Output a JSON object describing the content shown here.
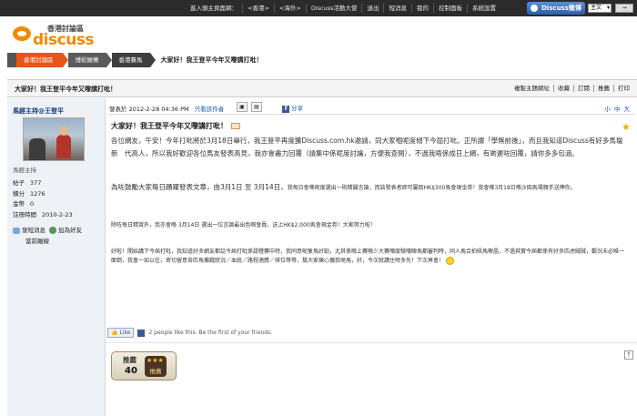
{
  "topnav": {
    "links": [
      "進入頭主頁面網：",
      "<香港>",
      "<海外>",
      "Discuss活動大使",
      "退出",
      "短消息",
      "我的",
      "控制面板",
      "系統設置"
    ],
    "brand": "Discuss微博",
    "language": "主文",
    "collapse_label": "→"
  },
  "logo": {
    "cn": "香港討論區",
    "en": "discuss"
  },
  "breadcrumb": {
    "items": [
      "香港討論區",
      "博彩娛樂",
      "香港賽馬"
    ],
    "current": "大家好！我王登平今年又嚟講打吡！"
  },
  "thread": {
    "title": "大家好！我王登平今年又嚟講打吡！",
    "actions": [
      "複製主題網址",
      "收藏",
      "訂閱",
      "推薦",
      "打印"
    ]
  },
  "user": {
    "name": "馬經主持@王登平",
    "rank": "馬經主持",
    "stats": [
      {
        "label": "帖子",
        "value": "377"
      },
      {
        "label": "積分",
        "value": "1276"
      },
      {
        "label": "金幣",
        "value": "0"
      },
      {
        "label": "註冊時間",
        "value": "2010-2-23"
      }
    ],
    "send_pm": "發短消息",
    "add_friend": "加為好友",
    "status": "當前離線"
  },
  "post": {
    "posted": "發表於 2012-2-28 04:36 PM",
    "only_author": "只看該作者",
    "share": "分享",
    "font_sizes": "小 中 大",
    "post_number": "1#",
    "title": "大家好！我王登平今年又嚟講打吡！",
    "p1": "各位網友，午安！今年打吡將於3月18日舉行，我王登平再度獲Discuss.com.hk邀請，同大家嗰呢度傾下今屆打吡。正所謂「學無前後」，而且我知道Discuss有好多馬壇新　代高人，所以我好歡迎各位馬友發表高見，我亦會盡力回覆（請集中係呢度討論，方便我查閱），不過我唔係成日上網，有啲遲咗回覆，請你多多包涵。",
    "p2a": "為咗鼓勵大家每日踴躍發表文章，由3月1日 至 3月14日，",
    "p2b": "我每日會喺呢度選出一則精闢言論，而該發表者即可贏取HK$300馬會現金券！我會喺3月18日喺沙田馬場親手送俾你。",
    "p3a": "除咗每日精賞外，我亦會喺 3月14日 選出一位言論最出色嘅會員，送上HK$2,000馬會現金券！大家努力啦！",
    "p4": "好啦！開始講下今屆打吡，我知道好多網友都話今屆打吡係甜橙賽中特，我同意呢隻馬好勁，尤其係喺上賽喺少大賽嗰度騎嗰陣馬都審判時，同人馬合拍唔馬嘢晶，不過其實今屆都係有好多匹虎賊賊，觀況未必唯一面倒，我會一如以往，密切留意各匹馬備戰狀況／血統／路程適應／排位等等，幫大家揀心儀我哋馬，好，今次就講住咁多先！下次再會！",
    "like_button": "Like",
    "like_text": "2 people like this. Be the first of your friends."
  },
  "recommend": {
    "label": "推薦",
    "count": "40",
    "button": "推薦"
  }
}
